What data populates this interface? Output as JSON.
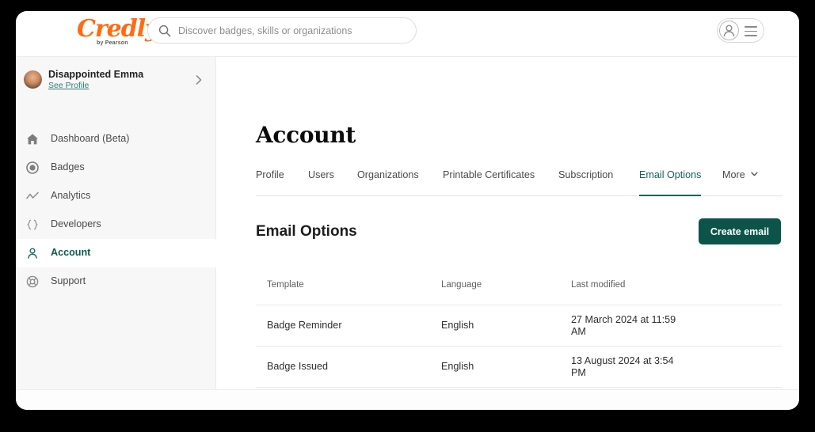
{
  "header": {
    "logo_text": "Credly",
    "logo_subtext": "by Pearson",
    "search": {
      "placeholder": "Discover badges, skills or organizations",
      "value": "",
      "icon": "search-icon"
    },
    "account_icon": "user-avatar-icon",
    "menu_icon": "hamburger-menu-icon"
  },
  "sidebar": {
    "profile": {
      "name": "Disappointed Emma",
      "link_label": "See Profile",
      "chevron_icon": "chevron-right-icon",
      "avatar_icon": "user-photo-avatar"
    },
    "items": [
      {
        "label": "Dashboard (Beta)",
        "icon": "home-icon",
        "active": false
      },
      {
        "label": "Badges",
        "icon": "badge-circle-icon",
        "active": false
      },
      {
        "label": "Analytics",
        "icon": "analytics-chart-icon",
        "active": false
      },
      {
        "label": "Developers",
        "icon": "code-braces-icon",
        "active": false
      },
      {
        "label": "Account",
        "icon": "person-icon",
        "active": true
      },
      {
        "label": "Support",
        "icon": "life-ring-icon",
        "active": false
      }
    ]
  },
  "main": {
    "page_title": "Account",
    "tabs": [
      {
        "label": "Profile",
        "active": false
      },
      {
        "label": "Users",
        "active": false
      },
      {
        "label": "Organizations",
        "active": false
      },
      {
        "label": "Printable Certificates",
        "active": false
      },
      {
        "label": "Subscription",
        "active": false
      },
      {
        "label": "Email Options",
        "active": true
      },
      {
        "label": "More",
        "active": false,
        "icon": "chevron-down-icon"
      }
    ],
    "section_title": "Email Options",
    "create_button_label": "Create email",
    "table": {
      "columns": [
        "Template",
        "Language",
        "Last modified"
      ],
      "rows": [
        {
          "template": "Badge Reminder",
          "language": "English",
          "last_modified": "27 March 2024 at 11:59 AM"
        },
        {
          "template": "Badge Issued",
          "language": "English",
          "last_modified": "13 August 2024 at 3:54 PM"
        }
      ]
    }
  },
  "colors": {
    "brand_orange": "#ff6b11",
    "accent_teal": "#14625a",
    "button_green": "#0c5449",
    "link_teal": "#2f7c76",
    "sidebar_bg": "#f7f7f7"
  }
}
